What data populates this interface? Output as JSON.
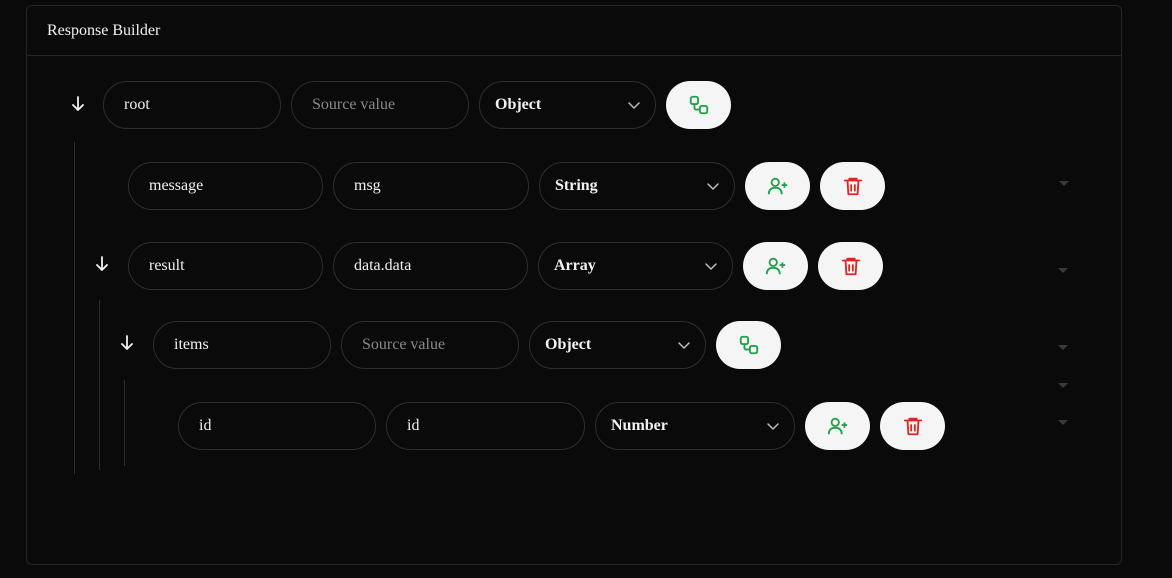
{
  "panel": {
    "title": "Response Builder"
  },
  "rows": {
    "root": {
      "name": "root",
      "source_placeholder": "Source value",
      "type": "Object"
    },
    "message": {
      "name": "message",
      "source": "msg",
      "type": "String"
    },
    "result": {
      "name": "result",
      "source": "data.data",
      "type": "Array"
    },
    "items": {
      "name": "items",
      "source_placeholder": "Source value",
      "type": "Object"
    },
    "id": {
      "name": "id",
      "source": "id",
      "type": "Number"
    }
  },
  "icons": {
    "collapse": "arrow-down-icon",
    "chevron": "chevron-down-icon",
    "add_child": "add-child-node-icon",
    "add_user": "user-plus-icon",
    "delete": "trash-icon"
  },
  "colors": {
    "background": "#0a0a0a",
    "border": "#2e2e2e",
    "text": "#f2f2f2",
    "placeholder": "#8a8a8a",
    "button_bg": "#f5f5f5",
    "green": "#22a04b",
    "red": "#dc2626"
  }
}
